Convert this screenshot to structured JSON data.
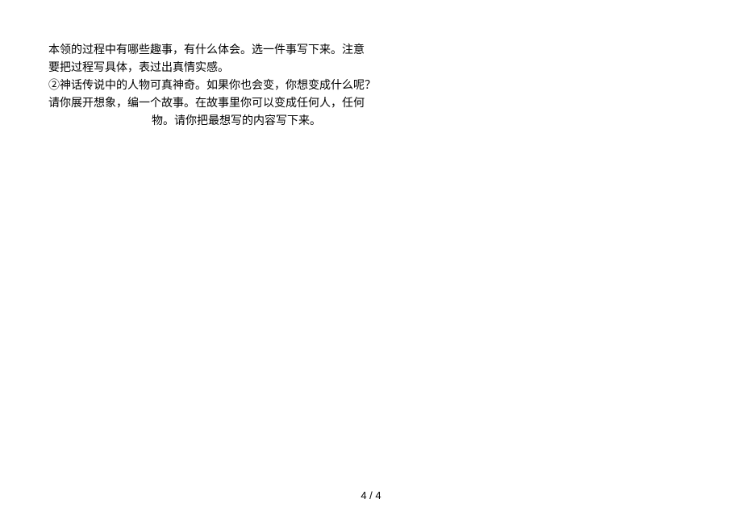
{
  "document": {
    "lines": [
      "本领的过程中有哪些趣事，有什么体会。选一件事写下来。注意",
      "要把过程写具体，表过出真情实感。",
      "②神话传说中的人物可真神奇。如果你也会变，你想变成什么呢？",
      "请你展开想象，编一个故事。在故事里你可以变成任何人，任何",
      "物。请你把最想写的内容写下来。"
    ],
    "page_number": "4 / 4"
  }
}
